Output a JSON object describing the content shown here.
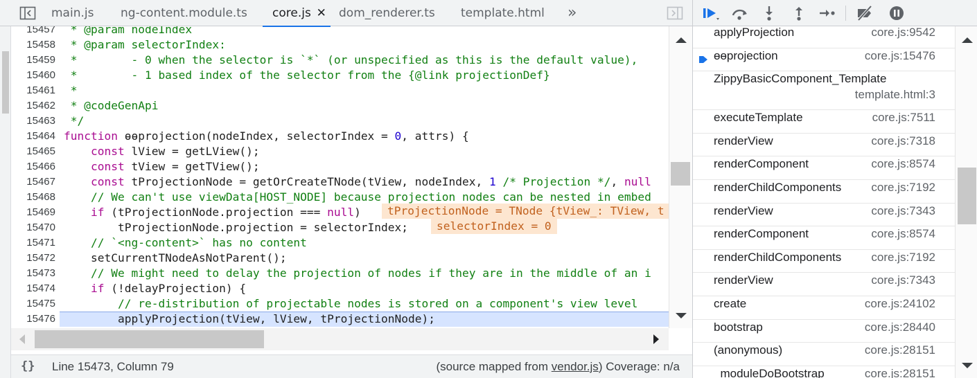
{
  "editor": {
    "tabs": [
      {
        "label": "main.js"
      },
      {
        "label": "ng-content.module.ts"
      },
      {
        "label": "core.js",
        "close": "✕"
      },
      {
        "label": "dom_renderer.ts"
      },
      {
        "label": "template.html"
      }
    ],
    "more_tabs": "»",
    "lines": [
      {
        "n": "15457",
        "html": "<span class=\"c\"> * @param nodeIndex</span>"
      },
      {
        "n": "15458",
        "html": "<span class=\"c\"> * @param selectorIndex:</span>"
      },
      {
        "n": "15459",
        "html": "<span class=\"c\"> *        - 0 when the selector is `*` (or unspecified as this is the default value),</span>"
      },
      {
        "n": "15460",
        "html": "<span class=\"c\"> *        - 1 based index of the selector from the {@link projectionDef}</span>"
      },
      {
        "n": "15461",
        "html": "<span class=\"c\"> *</span>"
      },
      {
        "n": "15462",
        "html": "<span class=\"c\"> * @codeGenApi</span>"
      },
      {
        "n": "15463",
        "html": "<span class=\"c\"> */</span>"
      },
      {
        "n": "15464",
        "html": "<span class=\"k\">function</span> ɵɵprojection(nodeIndex, selectorIndex = <span class=\"num\">0</span>, attrs) {"
      },
      {
        "n": "15465",
        "html": "    <span class=\"k\">const</span> lView = getLView();"
      },
      {
        "n": "15466",
        "html": "    <span class=\"k\">const</span> tView = getTView();"
      },
      {
        "n": "15467",
        "html": "    <span class=\"k\">const</span> tProjectionNode = getOrCreateTNode(tView, nodeIndex, <span class=\"num\">1</span> <span class=\"c\">/* Projection */</span>, <span class=\"k\">null</span>"
      },
      {
        "n": "15468",
        "html": "    <span class=\"c\">// We can't use viewData[HOST_NODE] because projection nodes can be nested in embed</span>"
      },
      {
        "n": "15469",
        "html": "    <span class=\"k\">if</span> (tProjectionNode.projection === <span class=\"k\">null</span>)"
      },
      {
        "n": "15470",
        "html": "        tProjectionNode.projection = selectorIndex;"
      },
      {
        "n": "15471",
        "html": "    <span class=\"c\">// `&lt;ng-content&gt;` has no content</span>"
      },
      {
        "n": "15472",
        "html": "    setCurrentTNodeAsNotParent();"
      },
      {
        "n": "15473",
        "html": "    <span class=\"c\">// We might need to delay the projection of nodes if they are in the middle of an i</span>"
      },
      {
        "n": "15474",
        "html": "    <span class=\"k\">if</span> (!delayProjection) {"
      },
      {
        "n": "15475",
        "html": "        <span class=\"c\">// re-distribution of projectable nodes is stored on a component's view level</span>"
      },
      {
        "n": "15476",
        "html": "        applyProjection(tView, lView, tProjectionNode);"
      }
    ],
    "inline_values": [
      {
        "text": "tProjectionNode = TNode {tView_: TView, t"
      },
      {
        "text": "selectorIndex = 0"
      }
    ],
    "current_line": "15476",
    "status": {
      "braces": "{}",
      "position": "Line 15473, Column 79",
      "mapped_prefix": "(source mapped from ",
      "mapped_link": "vendor.js",
      "mapped_suffix": ")  Coverage: n/a"
    }
  },
  "call_stack": {
    "frames": [
      {
        "name": "applyProjection",
        "location": "core.js:9542"
      },
      {
        "name": "ɵɵprojection",
        "location": "core.js:15476",
        "current": true
      },
      {
        "name": "ZippyBasicComponent_Template",
        "location": "template.html:3",
        "two_line": true
      },
      {
        "name": "executeTemplate",
        "location": "core.js:7511"
      },
      {
        "name": "renderView",
        "location": "core.js:7318"
      },
      {
        "name": "renderComponent",
        "location": "core.js:8574"
      },
      {
        "name": "renderChildComponents",
        "location": "core.js:7192"
      },
      {
        "name": "renderView",
        "location": "core.js:7343"
      },
      {
        "name": "renderComponent",
        "location": "core.js:8574"
      },
      {
        "name": "renderChildComponents",
        "location": "core.js:7192"
      },
      {
        "name": "renderView",
        "location": "core.js:7343"
      },
      {
        "name": "create",
        "location": "core.js:24102"
      },
      {
        "name": "bootstrap",
        "location": "core.js:28440"
      },
      {
        "name": "(anonymous)",
        "location": "core.js:28151"
      },
      {
        "name": "_moduleDoBootstrap",
        "location": "core.js:28151"
      }
    ]
  },
  "colors": {
    "accent": "#1a73e8",
    "comment": "#128013",
    "keyword": "#a90d91",
    "number": "#1c00cf",
    "inline_value_bg": "#fde6d0",
    "current_line_bg": "#d6e4ff"
  }
}
